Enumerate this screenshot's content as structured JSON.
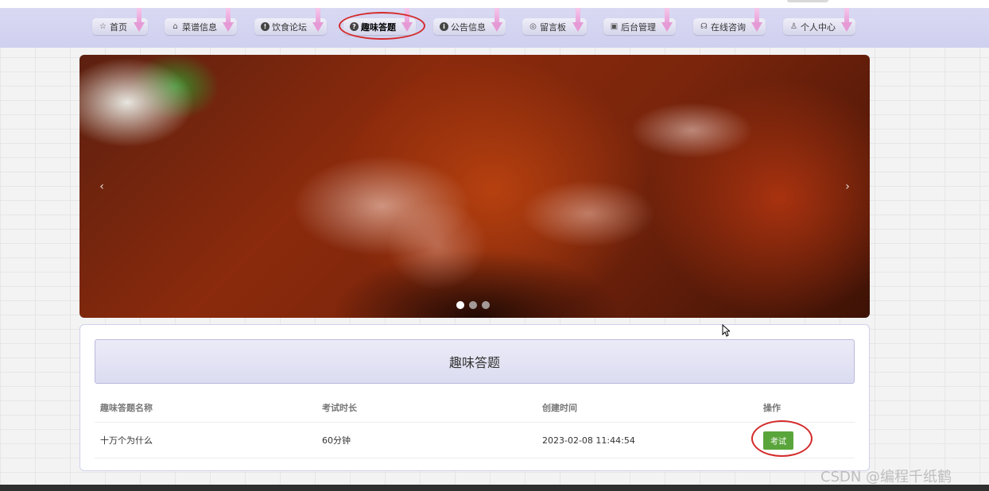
{
  "nav": {
    "items": [
      {
        "label": "首页",
        "icon": "star-icon",
        "glyph": "☆"
      },
      {
        "label": "菜谱信息",
        "icon": "bag-icon",
        "glyph": "⌂"
      },
      {
        "label": "饮食论坛",
        "icon": "info-icon",
        "glyph": "!"
      },
      {
        "label": "趣味答题",
        "icon": "question-icon",
        "glyph": "?"
      },
      {
        "label": "公告信息",
        "icon": "info-icon",
        "glyph": "i"
      },
      {
        "label": "留言板",
        "icon": "message-icon",
        "glyph": "◎"
      },
      {
        "label": "后台管理",
        "icon": "briefcase-icon",
        "glyph": "▣"
      },
      {
        "label": "在线咨询",
        "icon": "headset-icon",
        "glyph": "☊"
      },
      {
        "label": "个人中心",
        "icon": "user-icon",
        "glyph": "♙"
      }
    ],
    "active_index": 3
  },
  "carousel": {
    "prev_glyph": "‹",
    "next_glyph": "›",
    "dot_count": 3,
    "active_dot": 0
  },
  "quiz": {
    "title": "趣味答题",
    "headers": [
      "趣味答题名称",
      "考试时长",
      "创建时间",
      "操作"
    ],
    "rows": [
      {
        "name": "十万个为什么",
        "duration": "60分钟",
        "created": "2023-02-08 11:44:54",
        "action": "考试"
      }
    ]
  },
  "watermark": "CSDN @编程千纸鹤",
  "colors": {
    "nav_bg": "#d9d9f3",
    "accent_arrow": "#e59ad6",
    "exam_button": "#5aa53b",
    "highlight_ring": "#d42a2a"
  }
}
